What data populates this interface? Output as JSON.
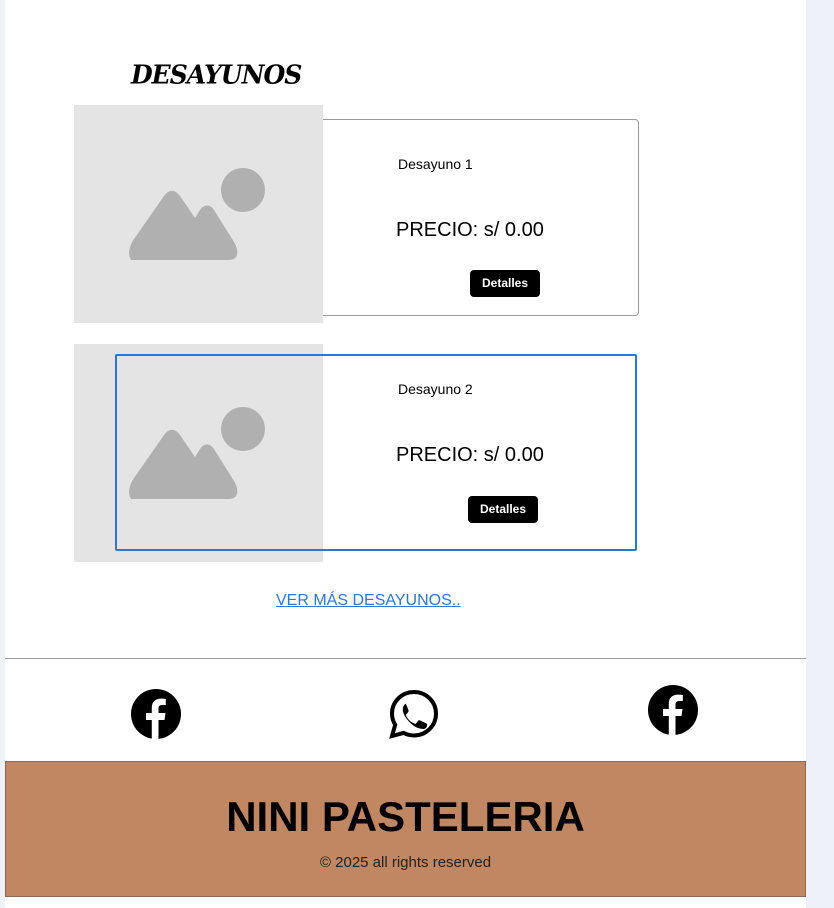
{
  "section": {
    "title": "DESAYUNOS"
  },
  "products": [
    {
      "name": "Desayuno 1",
      "price": "PRECIO: s/ 0.00",
      "button": "Detalles"
    },
    {
      "name": "Desayuno 2",
      "price": "PRECIO: s/ 0.00",
      "button": "Detalles"
    }
  ],
  "more_link": "VER MÁS DESAYUNOS..",
  "social": [
    {
      "icon": "facebook-icon"
    },
    {
      "icon": "whatsapp-icon"
    },
    {
      "icon": "facebook-icon"
    }
  ],
  "footer": {
    "title": "NINI PASTELERIA",
    "copyright": "© 2025 all rights reserved"
  },
  "colors": {
    "accent": "#2b77d8",
    "footer_bg": "#c08762",
    "placeholder_bg": "#e4e4e4",
    "placeholder_icon": "#b0b0b0"
  }
}
